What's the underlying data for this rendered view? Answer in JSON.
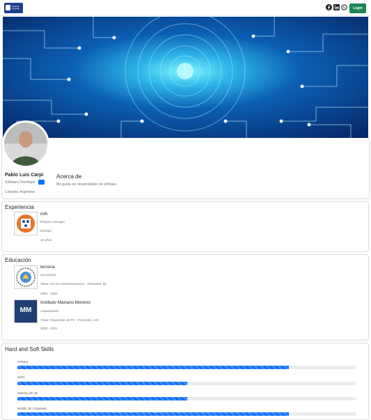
{
  "navbar": {
    "logo_text": "Argentina programa",
    "icons": [
      "facebook-icon",
      "linkedin-icon",
      "whatsapp-icon"
    ],
    "login_label": "Login"
  },
  "profile": {
    "name": "Pablo Luis Carpi",
    "role": "Software Developer",
    "location": "Córdoba, Argentina",
    "about_title": "Acerca de",
    "about_text": "Me gusta ser desarrollador de software"
  },
  "experience": {
    "title": "Experiencia",
    "items": [
      {
        "company": "mlh",
        "position": "Proyect manager",
        "type": "full time",
        "duration": "10 años"
      }
    ]
  },
  "education": {
    "title": "Educación",
    "items": [
      {
        "school": "tecnica",
        "level": "secundaria",
        "degree": "Título: tecnico electromecanico - Promedio: 65",
        "dates": "1994 - 2000"
      },
      {
        "school": "Instituto Mariano Moreno",
        "level": "Capacitación",
        "degree": "Título: Reparador de PC - Promedio: 100",
        "dates": "2000 - 2001",
        "logo_text": "MM"
      }
    ]
  },
  "skills": {
    "title": "Hard and Soft Skills",
    "items": [
      {
        "name": "HTML5",
        "percent": 80
      },
      {
        "name": "JAVA",
        "percent": 50
      },
      {
        "name": "ANGULAR JS",
        "percent": 50
      },
      {
        "name": "NODE JS + Express",
        "percent": 80
      }
    ]
  },
  "colors": {
    "primary": "#0d6efd",
    "login": "#198754",
    "banner": "#0b3b8c"
  }
}
